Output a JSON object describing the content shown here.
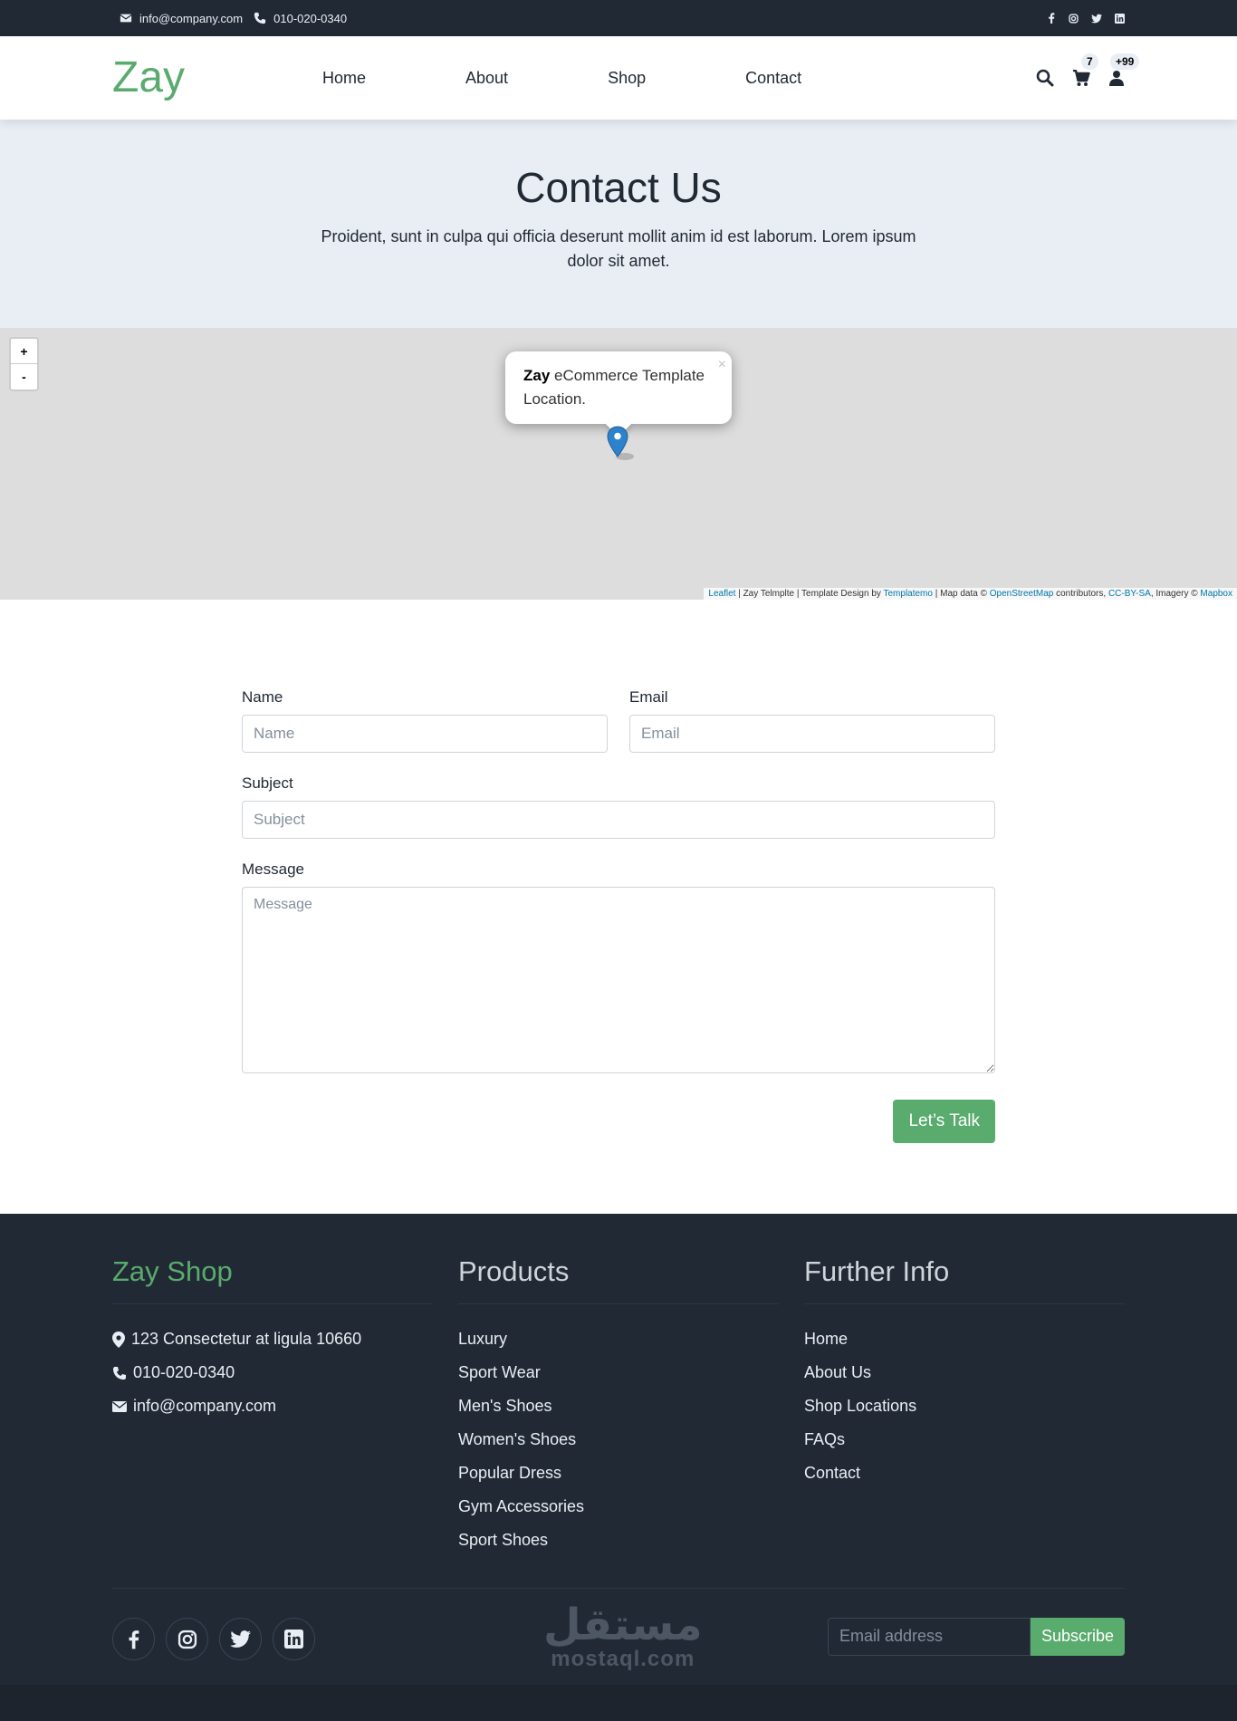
{
  "topbar": {
    "email": "info@company.com",
    "phone": "010-020-0340",
    "social_icons": [
      "facebook-icon",
      "instagram-icon",
      "twitter-icon",
      "linkedin-icon"
    ]
  },
  "header": {
    "logo": "Zay",
    "nav": [
      "Home",
      "About",
      "Shop",
      "Contact"
    ],
    "cart_count": "7",
    "user_count": "+99"
  },
  "hero": {
    "title": "Contact Us",
    "text": "Proident, sunt in culpa qui officia deserunt mollit anim id est laborum. Lorem ipsum dolor sit amet."
  },
  "map": {
    "zoom_in": "+",
    "zoom_out": "-",
    "popup_bold": "Zay",
    "popup_text": " eCommerce Template Location.",
    "popup_close": "×",
    "attribution": {
      "leaflet": "Leaflet",
      "part1": " | Zay Telmplte | Template Design by ",
      "templatemo": "Templatemo",
      "part2": " | Map data © ",
      "osm": "OpenStreetMap",
      "part3": " contributors, ",
      "ccbysa": "CC-BY-SA",
      "part4": ", Imagery © ",
      "mapbox": "Mapbox"
    }
  },
  "form": {
    "name_label": "Name",
    "name_placeholder": "Name",
    "email_label": "Email",
    "email_placeholder": "Email",
    "subject_label": "Subject",
    "subject_placeholder": "Subject",
    "message_label": "Message",
    "message_placeholder": "Message",
    "submit": "Let’s Talk"
  },
  "footer": {
    "brand": "Zay Shop",
    "address": "123 Consectetur at ligula 10660",
    "phone": "010-020-0340",
    "email": "info@company.com",
    "products_title": "Products",
    "products": [
      "Luxury",
      "Sport Wear",
      "Men's Shoes",
      "Women's Shoes",
      "Popular Dress",
      "Gym Accessories",
      "Sport Shoes"
    ],
    "info_title": "Further Info",
    "info": [
      "Home",
      "About Us",
      "Shop Locations",
      "FAQs",
      "Contact"
    ],
    "subscribe_placeholder": "Email address",
    "subscribe_button": "Subscribe",
    "watermark_ar": "مستقل",
    "watermark_en": "mostaql.com"
  },
  "colors": {
    "accent": "#59ab6e",
    "dark": "#212934",
    "light": "#e9eef5"
  }
}
